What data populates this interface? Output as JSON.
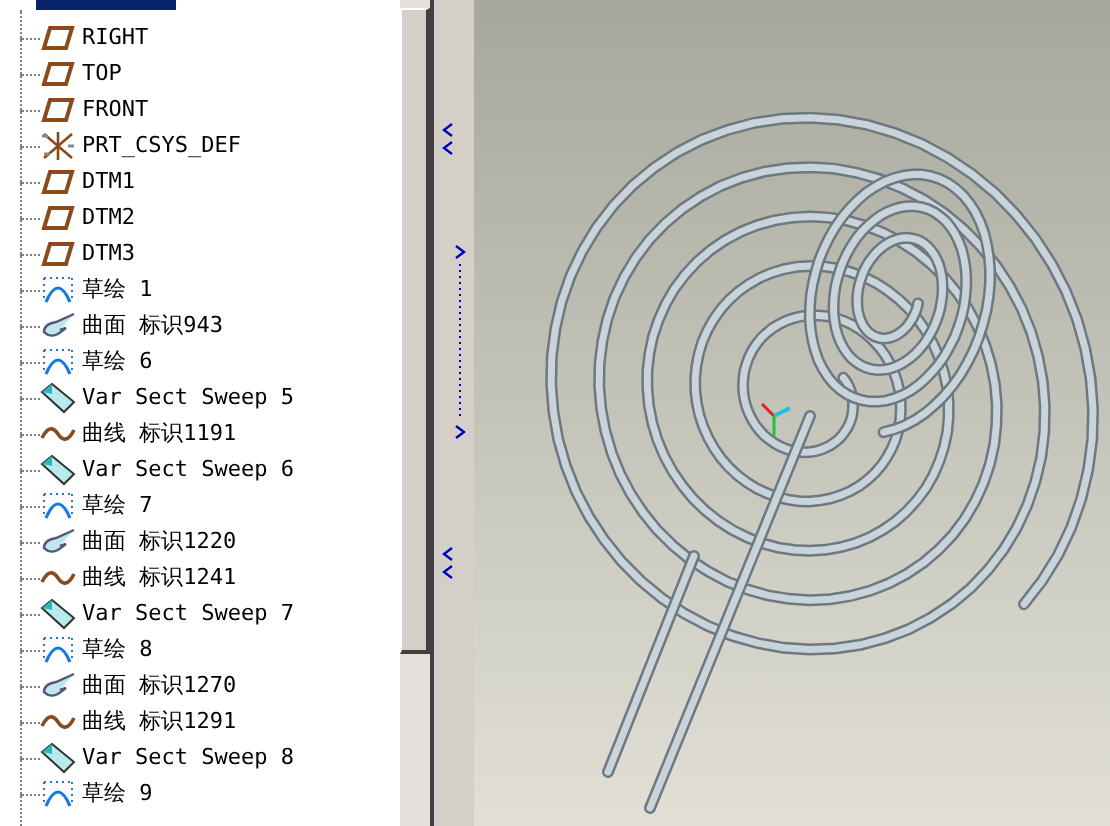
{
  "model_tree": {
    "items": [
      {
        "kind": "plane",
        "label": "RIGHT"
      },
      {
        "kind": "plane",
        "label": "TOP"
      },
      {
        "kind": "plane",
        "label": "FRONT"
      },
      {
        "kind": "csys",
        "label": "PRT_CSYS_DEF"
      },
      {
        "kind": "plane",
        "label": "DTM1"
      },
      {
        "kind": "plane",
        "label": "DTM2"
      },
      {
        "kind": "plane",
        "label": "DTM3"
      },
      {
        "kind": "sketch",
        "label": "草绘 1"
      },
      {
        "kind": "surface",
        "label": "曲面 标识943"
      },
      {
        "kind": "sketch",
        "label": "草绘 6"
      },
      {
        "kind": "sweep",
        "label": "Var Sect Sweep 5"
      },
      {
        "kind": "curve",
        "label": "曲线 标识1191"
      },
      {
        "kind": "sweep",
        "label": "Var Sect Sweep 6"
      },
      {
        "kind": "sketch",
        "label": "草绘 7"
      },
      {
        "kind": "surface",
        "label": "曲面 标识1220"
      },
      {
        "kind": "curve",
        "label": "曲线 标识1241"
      },
      {
        "kind": "sweep",
        "label": "Var Sect Sweep 7"
      },
      {
        "kind": "sketch",
        "label": "草绘 8"
      },
      {
        "kind": "surface",
        "label": "曲面 标识1270"
      },
      {
        "kind": "curve",
        "label": "曲线 标识1291"
      },
      {
        "kind": "sweep",
        "label": "Var Sect Sweep 8"
      },
      {
        "kind": "sketch",
        "label": "草绘 9"
      }
    ]
  }
}
